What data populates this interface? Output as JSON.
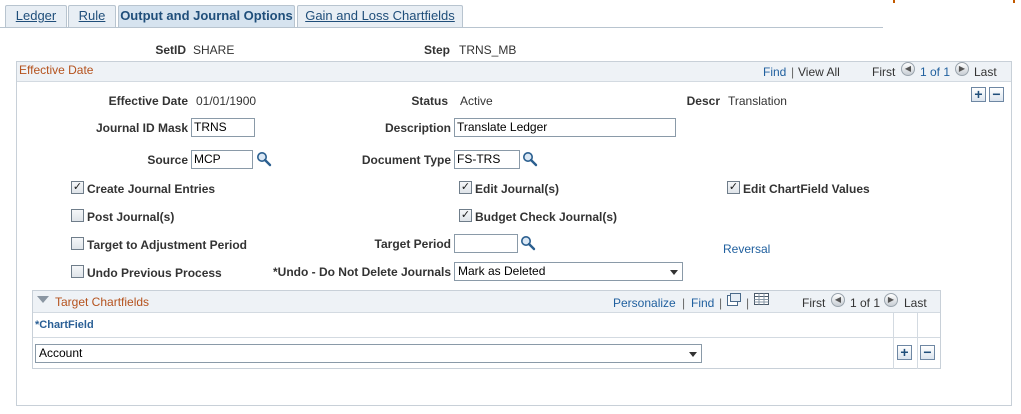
{
  "tabs": [
    {
      "label": "Ledger",
      "active": false
    },
    {
      "label": "Rule",
      "active": false
    },
    {
      "label": "Output and Journal Options",
      "active": true
    },
    {
      "label": "Gain and Loss Chartfields",
      "active": false
    }
  ],
  "header": {
    "setid_label": "SetID",
    "setid_value": "SHARE",
    "step_label": "Step",
    "step_value": "TRNS_MB"
  },
  "effective_date_group": {
    "title": "Effective Date",
    "find_label": "Find",
    "view_all_label": "View All",
    "first_label": "First",
    "page_info": "1 of 1",
    "last_label": "Last",
    "effective_date_label": "Effective Date",
    "effective_date_value": "01/01/1900",
    "status_label": "Status",
    "status_value": "Active",
    "descr_label": "Descr",
    "descr_value": "Translation",
    "journal_id_mask_label": "Journal ID Mask",
    "journal_id_mask_value": "TRNS",
    "description_label": "Description",
    "description_value": "Translate Ledger",
    "source_label": "Source",
    "source_value": "MCP",
    "document_type_label": "Document Type",
    "document_type_value": "FS-TRS",
    "checkboxes": {
      "create_journal_entries": {
        "label": "Create Journal Entries",
        "checked": true
      },
      "edit_journals": {
        "label": "Edit Journal(s)",
        "checked": true
      },
      "edit_chartfield_values": {
        "label": "Edit ChartField Values",
        "checked": true
      },
      "post_journals": {
        "label": "Post Journal(s)",
        "checked": false
      },
      "budget_check_journals": {
        "label": "Budget Check Journal(s)",
        "checked": true
      },
      "target_adjustment_period": {
        "label": "Target to Adjustment Period",
        "checked": false
      },
      "undo_previous_process": {
        "label": "Undo Previous Process",
        "checked": false
      }
    },
    "target_period_label": "Target Period",
    "target_period_value": "",
    "reversal_link": "Reversal",
    "undo_label": "*Undo - Do Not Delete Journals",
    "undo_value": "Mark as Deleted"
  },
  "target_chartfields": {
    "title": "Target Chartfields",
    "personalize_label": "Personalize",
    "find_label": "Find",
    "first_label": "First",
    "page_info": "1 of 1",
    "last_label": "Last",
    "column_header": "*ChartField",
    "rows": [
      {
        "chartfield": "Account"
      }
    ]
  }
}
